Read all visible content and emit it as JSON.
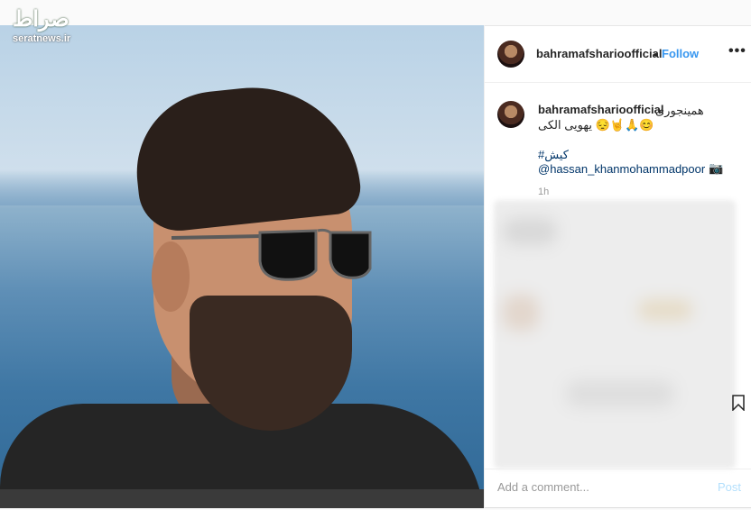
{
  "watermark": {
    "logo_text": "صراط",
    "site": "seratnews.ir"
  },
  "header": {
    "username": "bahramafsharioofficial",
    "separator": "•",
    "follow_label": "Follow",
    "more_label": "•••"
  },
  "caption": {
    "username": "bahramafsharioofficial",
    "line1": "همینجوری",
    "line2": "یهویی الکی 😔🤘🙏😊",
    "hashtag": "#کیش",
    "mention": "@hassan_khanmohammadpoor",
    "camera_icon": "📷",
    "time": "1h"
  },
  "comment": {
    "placeholder": "Add a comment...",
    "post_label": "Post"
  },
  "icons": {
    "more": "more-options-icon",
    "save": "bookmark-icon",
    "camera": "camera-icon"
  },
  "colors": {
    "follow": "#3897f0",
    "link": "#003569",
    "post_disabled": "#b2dffc"
  }
}
